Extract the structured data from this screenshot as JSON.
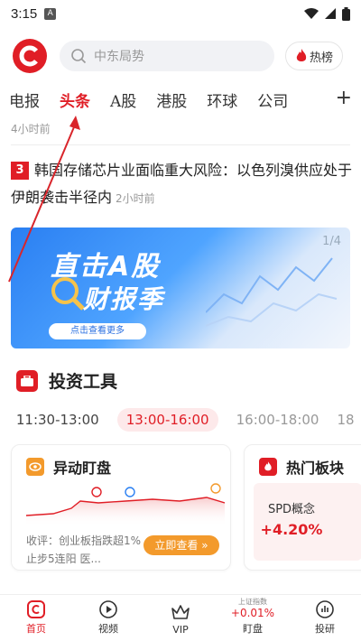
{
  "status_bar": {
    "time": "3:15",
    "notif_letter": "A"
  },
  "header": {
    "search_placeholder": "中东局势",
    "hot_label": "热榜"
  },
  "tabs": [
    "电报",
    "头条",
    "A股",
    "港股",
    "环球",
    "公司"
  ],
  "active_tab_index": 1,
  "prev_item_time": "4小时前",
  "news": {
    "rank": "3",
    "title": "韩国存储芯片业面临重大风险：以色列溴供应处于伊朗袭击半径内",
    "time": "2小时前"
  },
  "banner": {
    "title_line1": "直击A股",
    "title_line2": "财报季",
    "cta": "点击查看更多",
    "pager": "1/4"
  },
  "tools": {
    "title": "投资工具"
  },
  "timeline": {
    "slots": [
      "11:30-13:00",
      "13:00-16:00",
      "16:00-18:00",
      "18"
    ],
    "active_index": 1
  },
  "card_monitor": {
    "title": "异动盯盘",
    "comment": "收评：创业板指跌超1%止步5连阳 医...",
    "button": "立即查看 »"
  },
  "card_sector": {
    "title": "热门板块",
    "sector_name": "SPD概念",
    "sector_change": "+4.20%"
  },
  "bottom_nav": {
    "home": "首页",
    "video": "视频",
    "vip": "VIP",
    "watch": "盯盘",
    "research": "投研",
    "index_name": "上证指数",
    "index_change": "+0.01%"
  },
  "colors": {
    "brand_red": "#e01e26",
    "orange": "#f39a2c"
  }
}
